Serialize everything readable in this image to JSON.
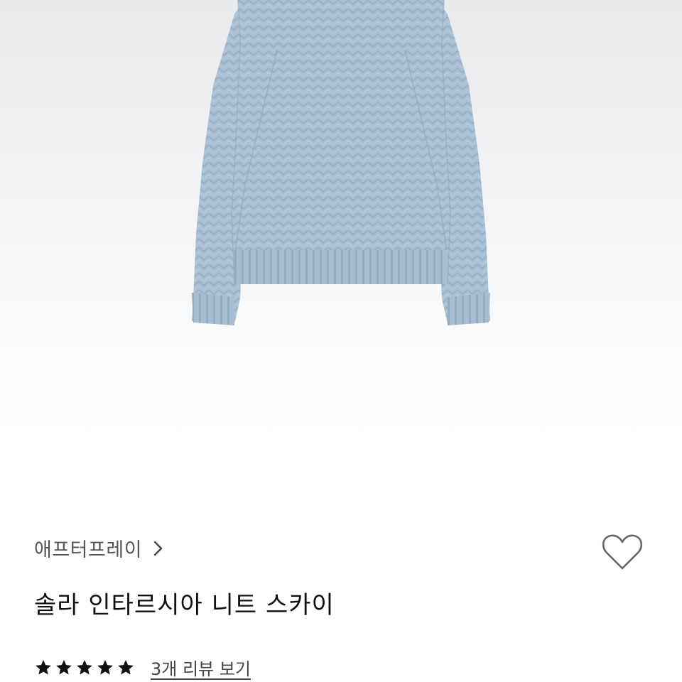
{
  "product": {
    "brand": "애프터프레이",
    "title": "솔라 인타르시아 니트 스카이",
    "rating": 5,
    "rating_max": 5,
    "review_link": "3개 리뷰 보기",
    "sweater_color": "#a9c0d4"
  },
  "icons": {
    "brand_chevron": "chevron-right-icon",
    "wishlist": "heart-outline-icon",
    "rating": "star-icon"
  }
}
